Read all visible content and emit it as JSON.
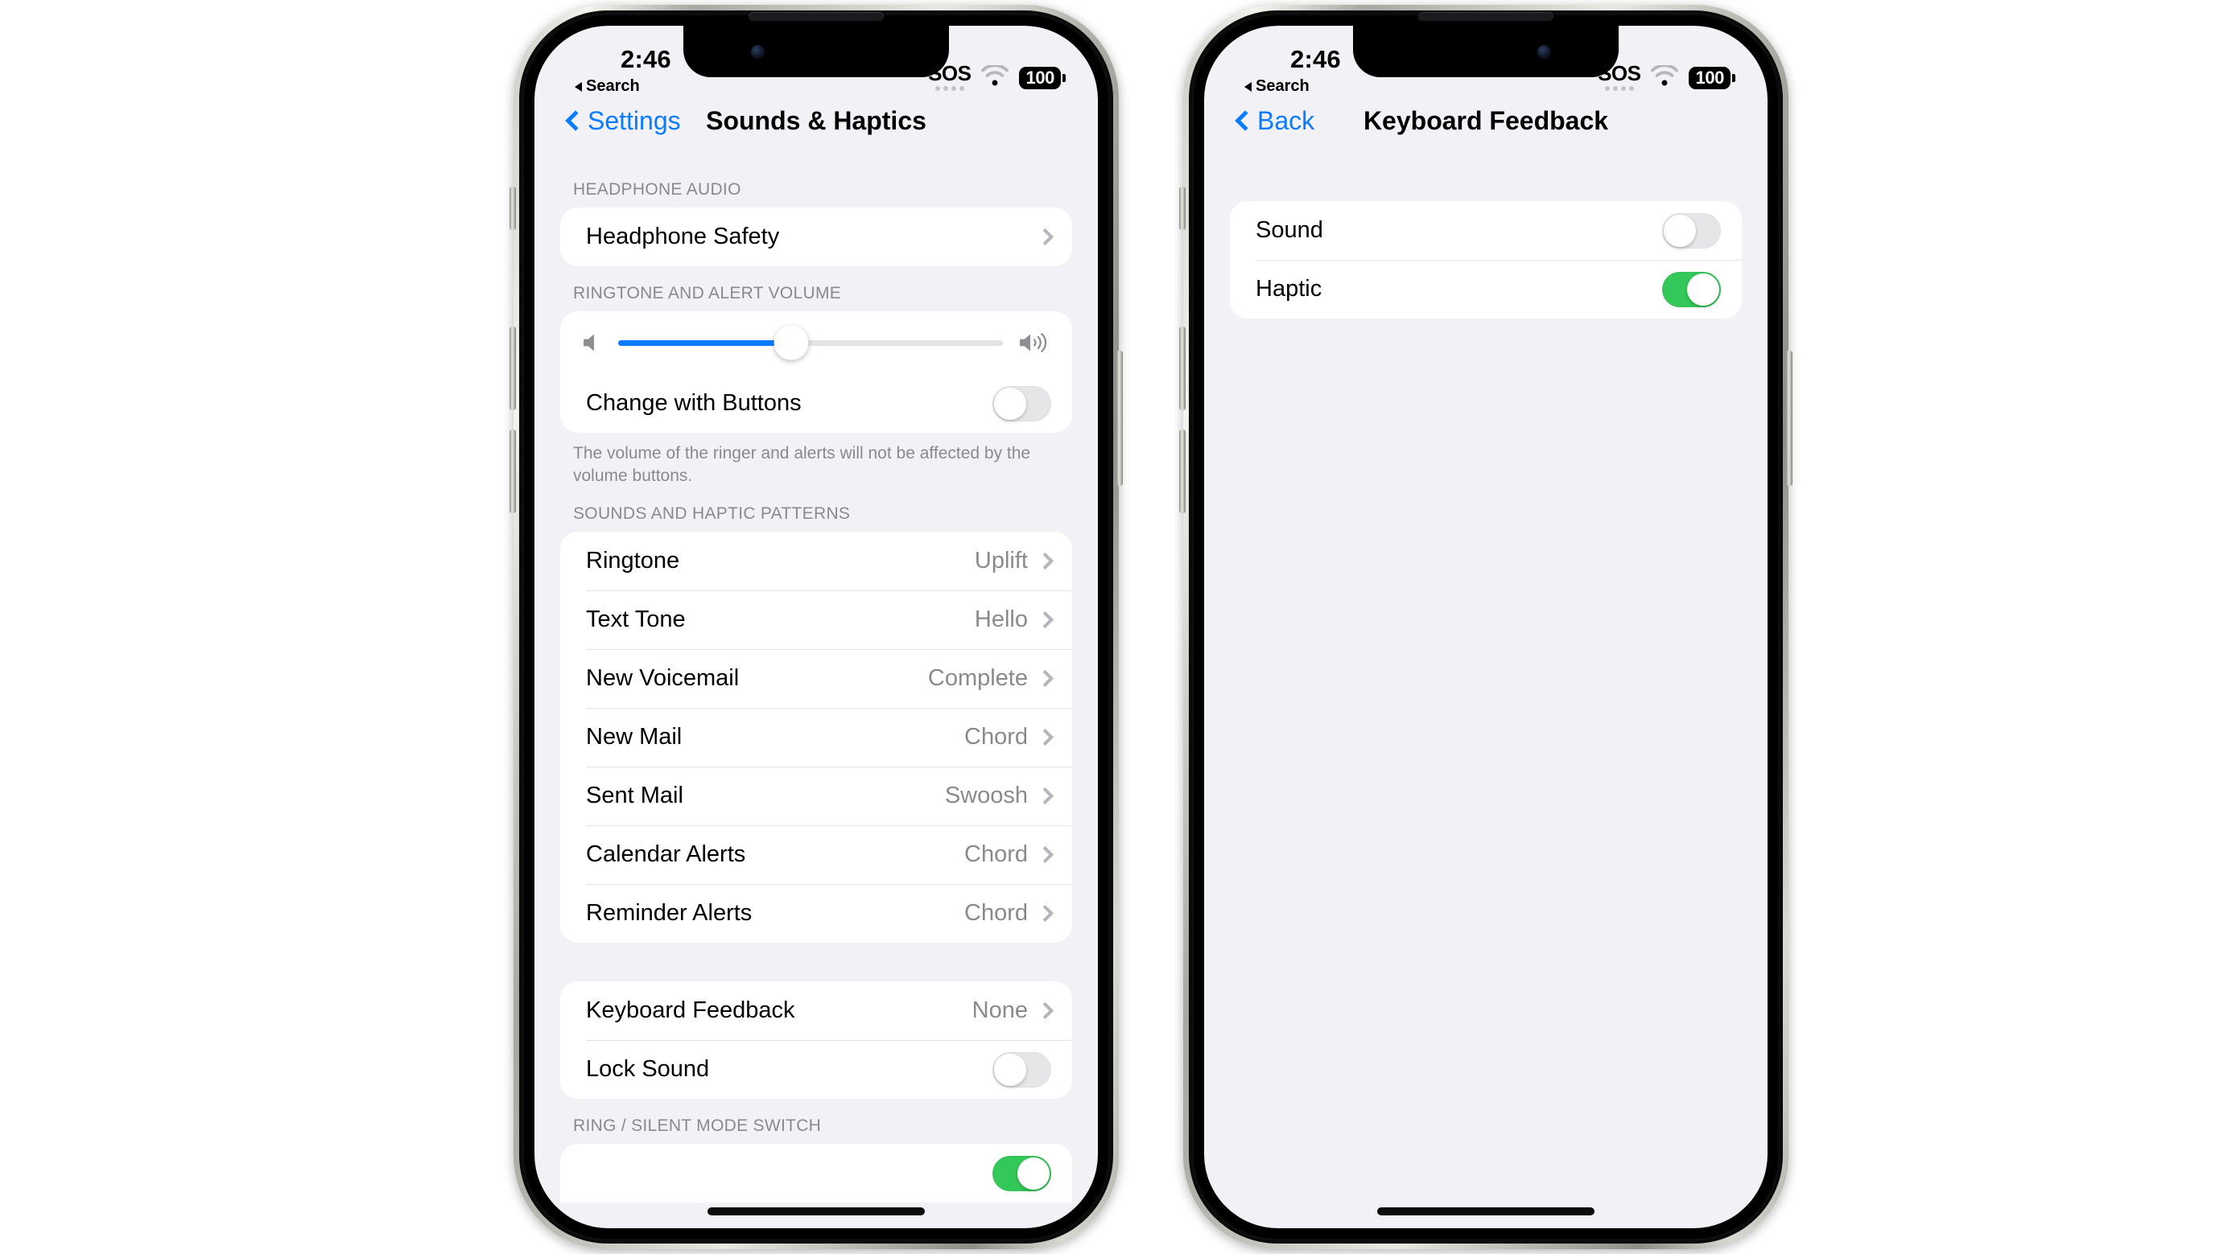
{
  "background_color": "#ffffff",
  "accent_color": "#0a7cff",
  "toggle_on_color": "#34c759",
  "phones": [
    {
      "status_bar": {
        "time": "2:46",
        "back_to_app": "Search",
        "sos_label": "SOS",
        "wifi_icon": "wifi-icon",
        "battery_level": "100"
      },
      "nav": {
        "back_label": "Settings",
        "title": "Sounds & Haptics"
      },
      "sections": [
        {
          "header": "HEADPHONE AUDIO",
          "rows": [
            {
              "label": "Headphone Safety",
              "type": "disclosure",
              "value": ""
            }
          ]
        },
        {
          "header": "RINGTONE AND ALERT VOLUME",
          "slider": {
            "value_percent": 45,
            "left_icon": "speaker-low-icon",
            "right_icon": "speaker-high-icon"
          },
          "rows": [
            {
              "label": "Change with Buttons",
              "type": "toggle",
              "on": false
            }
          ],
          "footer": "The volume of the ringer and alerts will not be affected by the volume buttons."
        },
        {
          "header": "SOUNDS AND HAPTIC PATTERNS",
          "rows": [
            {
              "label": "Ringtone",
              "type": "disclosure",
              "value": "Uplift"
            },
            {
              "label": "Text Tone",
              "type": "disclosure",
              "value": "Hello"
            },
            {
              "label": "New Voicemail",
              "type": "disclosure",
              "value": "Complete"
            },
            {
              "label": "New Mail",
              "type": "disclosure",
              "value": "Chord"
            },
            {
              "label": "Sent Mail",
              "type": "disclosure",
              "value": "Swoosh"
            },
            {
              "label": "Calendar Alerts",
              "type": "disclosure",
              "value": "Chord"
            },
            {
              "label": "Reminder Alerts",
              "type": "disclosure",
              "value": "Chord"
            }
          ]
        },
        {
          "header": "",
          "rows": [
            {
              "label": "Keyboard Feedback",
              "type": "disclosure",
              "value": "None"
            },
            {
              "label": "Lock Sound",
              "type": "toggle",
              "on": false
            }
          ]
        },
        {
          "header": "RING / SILENT MODE SWITCH",
          "rows": [
            {
              "label": "",
              "type": "toggle",
              "on": true
            }
          ]
        }
      ]
    },
    {
      "status_bar": {
        "time": "2:46",
        "back_to_app": "Search",
        "sos_label": "SOS",
        "wifi_icon": "wifi-icon",
        "battery_level": "100"
      },
      "nav": {
        "back_label": "Back",
        "title": "Keyboard Feedback"
      },
      "sections": [
        {
          "header": "",
          "rows": [
            {
              "label": "Sound",
              "type": "toggle",
              "on": false
            },
            {
              "label": "Haptic",
              "type": "toggle",
              "on": true
            }
          ]
        }
      ]
    }
  ]
}
